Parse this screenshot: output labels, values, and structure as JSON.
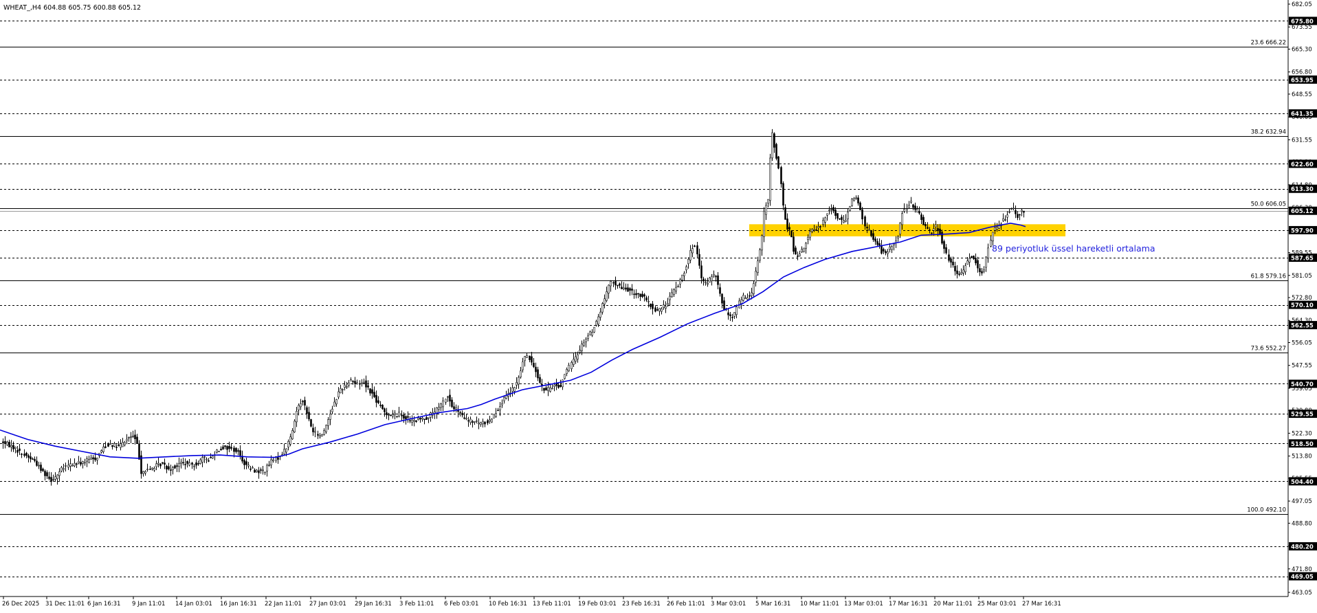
{
  "header": {
    "symbol_info": "WHEAT_,H4  604.88 605.75 600.88 605.12"
  },
  "chart_data": {
    "type": "candlestick",
    "title": "WHEAT_,H4  604.88 605.75 600.88 605.12",
    "timeframe": "H4",
    "ylim": [
      463.05,
      682.05
    ],
    "grid": false,
    "price_axis_ticks": [
      682.05,
      673.55,
      665.3,
      656.8,
      648.55,
      640.05,
      631.55,
      623.3,
      614.8,
      606.3,
      597.8,
      589.55,
      581.05,
      572.8,
      564.3,
      556.05,
      547.55,
      539.05,
      530.8,
      522.3,
      513.8,
      505.55,
      497.05,
      488.8,
      480.3,
      471.8,
      463.05
    ],
    "x_tick_labels": [
      "26 Dec 2025",
      "31 Dec 11:01",
      "6 Jan 16:31",
      "9 Jan 11:01",
      "14 Jan 03:01",
      "16 Jan 16:31",
      "22 Jan 11:01",
      "27 Jan 03:01",
      "29 Jan 16:31",
      "3 Feb 11:01",
      "6 Feb 03:01",
      "10 Feb 16:31",
      "13 Feb 11:01",
      "19 Feb 03:01",
      "23 Feb 16:31",
      "26 Feb 11:01",
      "3 Mar 03:01",
      "5 Mar 16:31",
      "10 Mar 11:01",
      "13 Mar 03:01",
      "17 Mar 16:31",
      "20 Mar 11:01",
      "25 Mar 03:01",
      "27 Mar 16:31"
    ],
    "horizontal_levels": [
      {
        "price": 675.8,
        "label": "675.80",
        "style": "dashed",
        "boxed": true
      },
      {
        "price": 653.95,
        "label": "653.95",
        "style": "dashed",
        "boxed": true
      },
      {
        "price": 641.35,
        "label": "641.35",
        "style": "dashed",
        "boxed": true
      },
      {
        "price": 622.6,
        "label": "622.60",
        "style": "dashed",
        "boxed": true
      },
      {
        "price": 613.3,
        "label": "613.30",
        "style": "dashed",
        "boxed": true
      },
      {
        "price": 597.9,
        "label": "597.90",
        "style": "dashed",
        "boxed": true
      },
      {
        "price": 587.65,
        "label": "587.65",
        "style": "dashed",
        "boxed": true
      },
      {
        "price": 570.1,
        "label": "570.10",
        "style": "dashed",
        "boxed": true
      },
      {
        "price": 562.55,
        "label": "562.55",
        "style": "dashed",
        "boxed": true
      },
      {
        "price": 540.7,
        "label": "540.70",
        "style": "dashed",
        "boxed": true
      },
      {
        "price": 529.55,
        "label": "529.55",
        "style": "dashed",
        "boxed": true
      },
      {
        "price": 518.5,
        "label": "518.50",
        "style": "dashed",
        "boxed": true
      },
      {
        "price": 504.4,
        "label": "504.40",
        "style": "dashed",
        "boxed": true
      },
      {
        "price": 480.2,
        "label": "480.20",
        "style": "dashed",
        "boxed": true
      },
      {
        "price": 469.05,
        "label": "469.05",
        "style": "dashed",
        "boxed": true
      }
    ],
    "fibonacci_levels": [
      {
        "price": 666.22,
        "label": "23.6 666.22"
      },
      {
        "price": 632.94,
        "label": "38.2 632.94"
      },
      {
        "price": 606.05,
        "label": "50.0 606.05"
      },
      {
        "price": 579.16,
        "label": "61.8 579.16"
      },
      {
        "price": 552.27,
        "label": "73.6 552.27"
      },
      {
        "price": 492.1,
        "label": "100.0 492.10"
      }
    ],
    "current_price": {
      "price": 605.12,
      "label": "605.12"
    },
    "support_zone": {
      "from": 595.6,
      "to": 600.1,
      "color": "#FFD200"
    },
    "annotation": {
      "text": "89 periyotluk üssel hareketli ortalama",
      "color": "#2222DD"
    },
    "ema_color": "#0000DD",
    "ema": [
      [
        0,
        523.5
      ],
      [
        40,
        520
      ],
      [
        80,
        517.5
      ],
      [
        120,
        515.5
      ],
      [
        160,
        513.5
      ],
      [
        200,
        513
      ],
      [
        240,
        513.5
      ],
      [
        280,
        514
      ],
      [
        320,
        514.2
      ],
      [
        360,
        513.5
      ],
      [
        400,
        513.3
      ],
      [
        420,
        514.5
      ],
      [
        440,
        516.5
      ],
      [
        480,
        519
      ],
      [
        520,
        522
      ],
      [
        560,
        525.5
      ],
      [
        600,
        527.8
      ],
      [
        640,
        530
      ],
      [
        680,
        531.5
      ],
      [
        700,
        533
      ],
      [
        720,
        535
      ],
      [
        760,
        538.5
      ],
      [
        800,
        540.5
      ],
      [
        830,
        542
      ],
      [
        860,
        545
      ],
      [
        890,
        549.5
      ],
      [
        920,
        553.5
      ],
      [
        960,
        558
      ],
      [
        1000,
        563
      ],
      [
        1040,
        567
      ],
      [
        1080,
        570.5
      ],
      [
        1110,
        575
      ],
      [
        1140,
        580.5
      ],
      [
        1170,
        584
      ],
      [
        1200,
        587
      ],
      [
        1240,
        590
      ],
      [
        1280,
        592
      ],
      [
        1310,
        593.5
      ],
      [
        1340,
        596
      ],
      [
        1380,
        596.5
      ],
      [
        1410,
        597
      ],
      [
        1440,
        599
      ],
      [
        1470,
        600.5
      ],
      [
        1485,
        599.8
      ],
      [
        1492,
        599.2
      ]
    ],
    "price_path": [
      [
        4,
        519
      ],
      [
        12,
        518
      ],
      [
        20,
        517
      ],
      [
        30,
        515
      ],
      [
        40,
        513.5
      ],
      [
        50,
        512
      ],
      [
        58,
        509
      ],
      [
        66,
        507
      ],
      [
        74,
        505
      ],
      [
        82,
        506.5
      ],
      [
        90,
        509
      ],
      [
        100,
        510.5
      ],
      [
        110,
        511
      ],
      [
        120,
        511.5
      ],
      [
        130,
        512.5
      ],
      [
        140,
        513
      ],
      [
        150,
        517
      ],
      [
        160,
        518.5
      ],
      [
        170,
        517
      ],
      [
        180,
        519
      ],
      [
        188,
        521
      ],
      [
        195,
        521
      ],
      [
        200,
        517.5
      ],
      [
        205,
        508
      ],
      [
        215,
        508.5
      ],
      [
        225,
        510
      ],
      [
        235,
        511
      ],
      [
        245,
        509
      ],
      [
        255,
        510
      ],
      [
        265,
        511.5
      ],
      [
        275,
        510.5
      ],
      [
        285,
        511
      ],
      [
        295,
        513
      ],
      [
        305,
        512.5
      ],
      [
        315,
        516
      ],
      [
        325,
        517
      ],
      [
        335,
        516.5
      ],
      [
        345,
        515.5
      ],
      [
        355,
        511
      ],
      [
        365,
        509
      ],
      [
        375,
        508
      ],
      [
        385,
        508.5
      ],
      [
        395,
        512
      ],
      [
        405,
        513.5
      ],
      [
        415,
        516.5
      ],
      [
        425,
        523
      ],
      [
        432,
        532
      ],
      [
        440,
        535
      ],
      [
        447,
        529
      ],
      [
        455,
        523
      ],
      [
        465,
        521
      ],
      [
        472,
        524
      ],
      [
        480,
        530
      ],
      [
        488,
        535
      ],
      [
        495,
        539
      ],
      [
        503,
        540
      ],
      [
        510,
        542.5
      ],
      [
        518,
        540.5
      ],
      [
        528,
        541.5
      ],
      [
        535,
        539
      ],
      [
        542,
        536.5
      ],
      [
        550,
        533
      ],
      [
        560,
        530
      ],
      [
        570,
        529
      ],
      [
        580,
        529.5
      ],
      [
        590,
        528
      ],
      [
        600,
        526.5
      ],
      [
        610,
        527.5
      ],
      [
        620,
        528
      ],
      [
        630,
        530
      ],
      [
        640,
        532
      ],
      [
        650,
        536.5
      ],
      [
        657,
        532
      ],
      [
        664,
        531
      ],
      [
        672,
        528.5
      ],
      [
        680,
        527
      ],
      [
        690,
        526.5
      ],
      [
        700,
        526
      ],
      [
        710,
        526.5
      ],
      [
        720,
        530
      ],
      [
        730,
        534
      ],
      [
        740,
        537
      ],
      [
        750,
        540
      ],
      [
        757,
        545
      ],
      [
        762,
        551
      ],
      [
        770,
        550
      ],
      [
        778,
        546.5
      ],
      [
        785,
        541
      ],
      [
        792,
        538
      ],
      [
        800,
        539
      ],
      [
        808,
        540.5
      ],
      [
        814,
        539
      ],
      [
        822,
        545
      ],
      [
        830,
        548
      ],
      [
        838,
        551
      ],
      [
        845,
        555
      ],
      [
        853,
        558
      ],
      [
        860,
        560
      ],
      [
        868,
        564
      ],
      [
        875,
        569
      ],
      [
        880,
        573
      ],
      [
        888,
        578.5
      ],
      [
        896,
        578
      ],
      [
        904,
        576
      ],
      [
        912,
        576
      ],
      [
        920,
        574.5
      ],
      [
        928,
        574
      ],
      [
        936,
        573
      ],
      [
        944,
        570.5
      ],
      [
        952,
        568
      ],
      [
        960,
        568.5
      ],
      [
        968,
        570
      ],
      [
        975,
        573.5
      ],
      [
        982,
        576
      ],
      [
        988,
        578.5
      ],
      [
        995,
        582.5
      ],
      [
        1002,
        588
      ],
      [
        1008,
        592
      ],
      [
        1012,
        591
      ],
      [
        1016,
        585
      ],
      [
        1020,
        579
      ],
      [
        1026,
        578
      ],
      [
        1033,
        580
      ],
      [
        1040,
        581.5
      ],
      [
        1046,
        575
      ],
      [
        1052,
        569
      ],
      [
        1058,
        567.5
      ],
      [
        1063,
        565
      ],
      [
        1068,
        566.5
      ],
      [
        1074,
        571
      ],
      [
        1080,
        573
      ],
      [
        1086,
        572.5
      ],
      [
        1093,
        575
      ],
      [
        1100,
        584
      ],
      [
        1107,
        593
      ],
      [
        1112,
        606.5
      ],
      [
        1118,
        609
      ],
      [
        1122,
        636
      ],
      [
        1128,
        627
      ],
      [
        1134,
        618.5
      ],
      [
        1139,
        606
      ],
      [
        1144,
        599
      ],
      [
        1150,
        596.5
      ],
      [
        1155,
        589
      ],
      [
        1160,
        588
      ],
      [
        1166,
        590
      ],
      [
        1172,
        593.5
      ],
      [
        1178,
        597
      ],
      [
        1185,
        598
      ],
      [
        1190,
        598.5
      ],
      [
        1196,
        601
      ],
      [
        1203,
        605
      ],
      [
        1210,
        606
      ],
      [
        1216,
        603
      ],
      [
        1222,
        602
      ],
      [
        1228,
        600.5
      ],
      [
        1234,
        606
      ],
      [
        1240,
        610
      ],
      [
        1246,
        609.5
      ],
      [
        1252,
        605
      ],
      [
        1258,
        599
      ],
      [
        1264,
        597.5
      ],
      [
        1270,
        594.5
      ],
      [
        1276,
        593
      ],
      [
        1282,
        590
      ],
      [
        1288,
        589
      ],
      [
        1294,
        591
      ],
      [
        1300,
        593
      ],
      [
        1306,
        595.5
      ],
      [
        1312,
        604
      ],
      [
        1318,
        606.5
      ],
      [
        1324,
        608.5
      ],
      [
        1330,
        605
      ],
      [
        1336,
        605
      ],
      [
        1342,
        601
      ],
      [
        1348,
        598.5
      ],
      [
        1354,
        597
      ],
      [
        1360,
        599.5
      ],
      [
        1366,
        598
      ],
      [
        1372,
        592
      ],
      [
        1378,
        588
      ],
      [
        1384,
        585
      ],
      [
        1390,
        582
      ],
      [
        1396,
        581
      ],
      [
        1402,
        583.5
      ],
      [
        1408,
        587
      ],
      [
        1414,
        588.5
      ],
      [
        1420,
        586
      ],
      [
        1426,
        581.5
      ],
      [
        1432,
        584
      ],
      [
        1438,
        592
      ],
      [
        1444,
        598
      ],
      [
        1450,
        598.5
      ],
      [
        1456,
        601
      ],
      [
        1462,
        602.5
      ],
      [
        1468,
        605.5
      ],
      [
        1474,
        606
      ],
      [
        1480,
        603
      ],
      [
        1486,
        605
      ],
      [
        1490,
        605.12
      ]
    ]
  }
}
